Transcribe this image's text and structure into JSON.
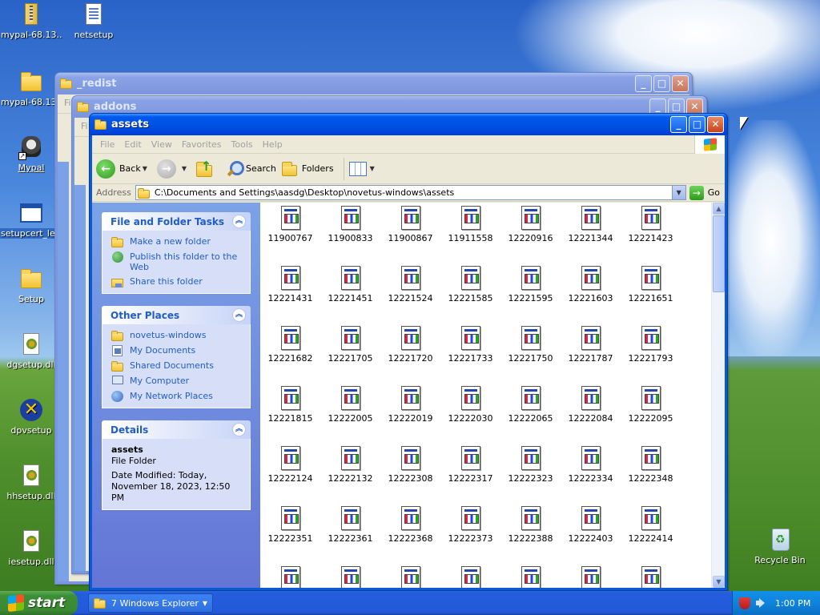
{
  "desktop": {
    "icons": [
      {
        "label": "mypal-68.13...",
        "type": "zip"
      },
      {
        "label": "netsetup",
        "type": "doc"
      },
      {
        "label": "mypal-68.13...",
        "type": "folder"
      },
      {
        "label": "Mypal",
        "type": "mypal"
      },
      {
        "label": "setupcert_le...",
        "type": "window"
      },
      {
        "label": "Setup",
        "type": "folder"
      },
      {
        "label": "dgsetup.dll",
        "type": "dll"
      },
      {
        "label": "dpvsetup",
        "type": "x"
      },
      {
        "label": "hhsetup.dll",
        "type": "dll"
      },
      {
        "label": "iesetup.dll",
        "type": "dll"
      },
      {
        "label": "Recycle Bin",
        "type": "recycle"
      }
    ]
  },
  "windows": {
    "redist": {
      "title": "_redist"
    },
    "addons": {
      "title": "addons"
    },
    "assets": {
      "title": "assets",
      "menu": [
        "File",
        "Edit",
        "View",
        "Favorites",
        "Tools",
        "Help"
      ],
      "toolbar": {
        "back": "Back",
        "search": "Search",
        "folders": "Folders"
      },
      "address": {
        "label": "Address",
        "value": "C:\\Documents and Settings\\aasdg\\Desktop\\novetus-windows\\assets",
        "go": "Go"
      },
      "tasks": {
        "title": "File and Folder Tasks",
        "items": [
          "Make a new folder",
          "Publish this folder to the Web",
          "Share this folder"
        ]
      },
      "places": {
        "title": "Other Places",
        "items": [
          "novetus-windows",
          "My Documents",
          "Shared Documents",
          "My Computer",
          "My Network Places"
        ]
      },
      "details": {
        "title": "Details",
        "name": "assets",
        "type": "File Folder",
        "modified": "Date Modified: Today, November 18, 2023, 12:50 PM"
      },
      "files": [
        "11900767",
        "11900833",
        "11900867",
        "11911558",
        "12220916",
        "12221344",
        "12221423",
        "12221431",
        "12221451",
        "12221524",
        "12221585",
        "12221595",
        "12221603",
        "12221651",
        "12221682",
        "12221705",
        "12221720",
        "12221733",
        "12221750",
        "12221787",
        "12221793",
        "12221815",
        "12222005",
        "12222019",
        "12222030",
        "12222065",
        "12222084",
        "12222095",
        "12222124",
        "12222132",
        "12222308",
        "12222317",
        "12222323",
        "12222334",
        "12222348",
        "12222351",
        "12222361",
        "12222368",
        "12222373",
        "12222388",
        "12222403",
        "12222414",
        "",
        "",
        "",
        "",
        "",
        "",
        ""
      ]
    }
  },
  "taskbar": {
    "start": "start",
    "task": "7 Windows Explorer",
    "clock": "1:00 PM"
  }
}
